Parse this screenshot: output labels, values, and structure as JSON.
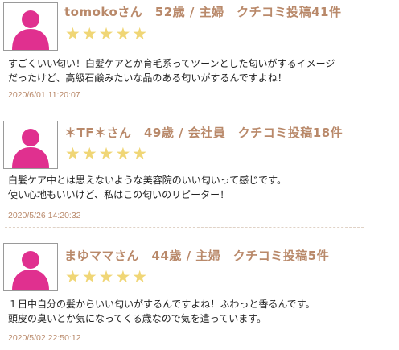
{
  "reviews": [
    {
      "header": "tomokoさん　52歳 / 主婦　クチコミ投稿41件",
      "stars": "★★★★★",
      "rating": 5,
      "lines": [
        "すごくいい匂い！白髪ケアとか育毛系ってツーンとした匂いがするイメージ",
        "だったけど、高級石鹸みたいな品のある匂いがするんですよね！"
      ],
      "date": "2020/6/01 11:20:07"
    },
    {
      "header": "＊TF＊さん　49歳 / 会社員　クチコミ投稿18件",
      "stars": "★★★★★",
      "rating": 5,
      "lines": [
        "白髪ケア中とは思えないような美容院のいい匂いって感じです。",
        "使い心地もいいけど、私はこの匂いのリピーター！"
      ],
      "date": "2020/5/26 14:20:32"
    },
    {
      "header": "まゆママさん　44歳 / 主婦　クチコミ投稿5件",
      "stars": "★★★★★",
      "rating": 5,
      "lines": [
        "１日中自分の髪からいい匂いがするんですよね！ふわっと香るんです。",
        "頭皮の臭いとか気になってくる歳なので気を遣っています。"
      ],
      "date": "2020/5/02 22:50:12"
    }
  ],
  "colors": {
    "accent": "#b9896a",
    "star": "#f0d676",
    "avatar": "#e0308f",
    "divider": "#e0d2c6"
  },
  "icons": {
    "avatar": "user-silhouette-icon"
  }
}
